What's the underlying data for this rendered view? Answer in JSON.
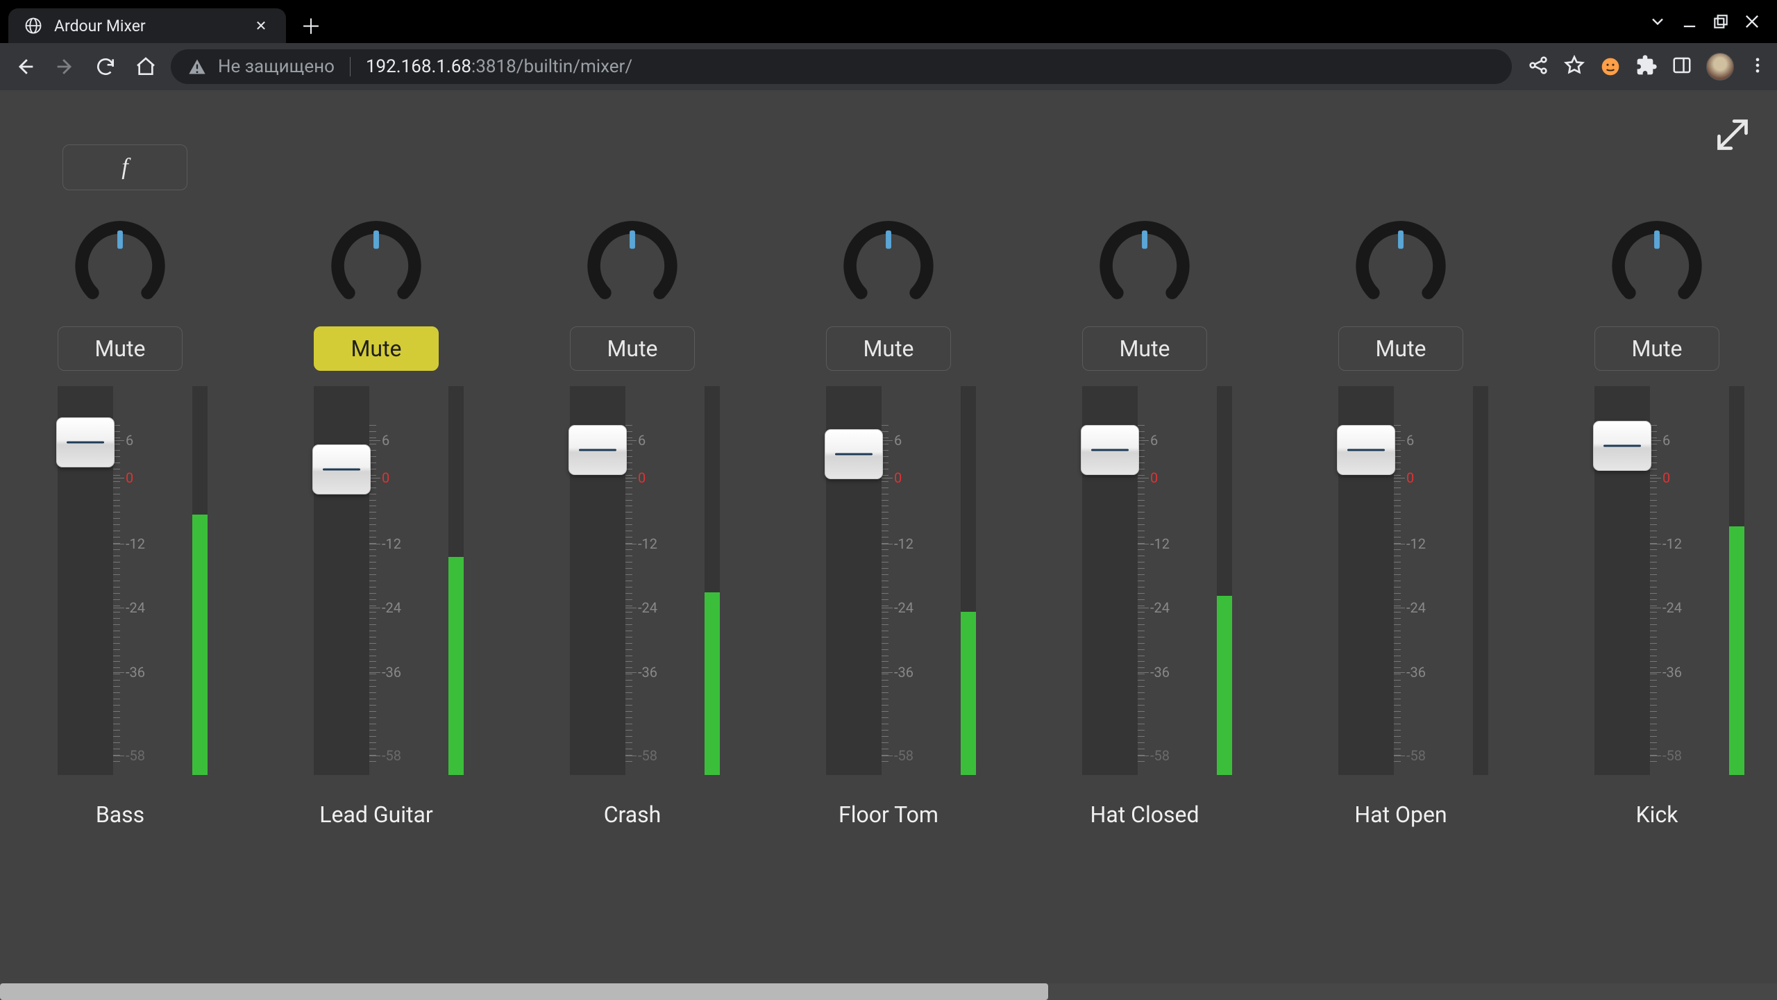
{
  "window": {
    "tab_title": "Ardour Mixer",
    "security_label": "Не защищено",
    "url_host": "192.168.1.68",
    "url_path": ":3818/builtin/mixer/"
  },
  "fbutton_label": "f",
  "mute_label": "Mute",
  "scale_labels": {
    "p6": "6",
    "zero": "0",
    "m12": "-12",
    "m24": "-24",
    "m36": "-36",
    "m58": "-58"
  },
  "channels": [
    {
      "name": "Bass",
      "muted": false,
      "fader_pos_pct": 8,
      "meter_fill_pct": 67
    },
    {
      "name": "Lead Guitar",
      "muted": true,
      "fader_pos_pct": 15,
      "meter_fill_pct": 56
    },
    {
      "name": "Crash",
      "muted": false,
      "fader_pos_pct": 10,
      "meter_fill_pct": 47
    },
    {
      "name": "Floor Tom",
      "muted": false,
      "fader_pos_pct": 11,
      "meter_fill_pct": 42
    },
    {
      "name": "Hat Closed",
      "muted": false,
      "fader_pos_pct": 10,
      "meter_fill_pct": 46
    },
    {
      "name": "Hat Open",
      "muted": false,
      "fader_pos_pct": 10,
      "meter_fill_pct": 0
    },
    {
      "name": "Kick",
      "muted": false,
      "fader_pos_pct": 9,
      "meter_fill_pct": 64
    }
  ]
}
